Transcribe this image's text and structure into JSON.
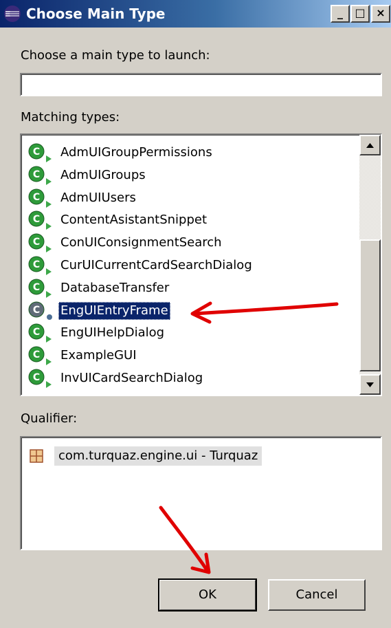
{
  "window": {
    "title": "Choose Main Type",
    "icon": "eclipse-icon",
    "controls": {
      "minimize": "_",
      "maximize": "□",
      "close": "×"
    }
  },
  "search": {
    "label": "Choose a main type to launch:",
    "value": "",
    "placeholder": ""
  },
  "matching": {
    "label": "Matching types:",
    "items": [
      {
        "label": "AdmUIGroupPermissions",
        "icon": "class-icon"
      },
      {
        "label": "AdmUIGroups",
        "icon": "class-icon"
      },
      {
        "label": "AdmUIUsers",
        "icon": "class-icon"
      },
      {
        "label": "ContentAsistantSnippet",
        "icon": "class-icon"
      },
      {
        "label": "ConUIConsignmentSearch",
        "icon": "class-icon"
      },
      {
        "label": "CurUICurrentCardSearchDialog",
        "icon": "class-icon"
      },
      {
        "label": "DatabaseTransfer",
        "icon": "class-icon"
      },
      {
        "label": "EngUIEntryFrame",
        "icon": "class-icon",
        "selected": true
      },
      {
        "label": "EngUIHelpDialog",
        "icon": "class-icon"
      },
      {
        "label": "ExampleGUI",
        "icon": "class-icon"
      },
      {
        "label": "InvUICardSearchDialog",
        "icon": "class-icon"
      }
    ]
  },
  "qualifier": {
    "label": "Qualifier:",
    "items": [
      {
        "label": "com.turquaz.engine.ui - Turquaz",
        "icon": "package-icon"
      }
    ]
  },
  "buttons": {
    "ok": "OK",
    "cancel": "Cancel"
  },
  "colors": {
    "selection": "#0a246a",
    "class_icon": "#2e9b3a",
    "annotation_arrow": "#e00000"
  }
}
